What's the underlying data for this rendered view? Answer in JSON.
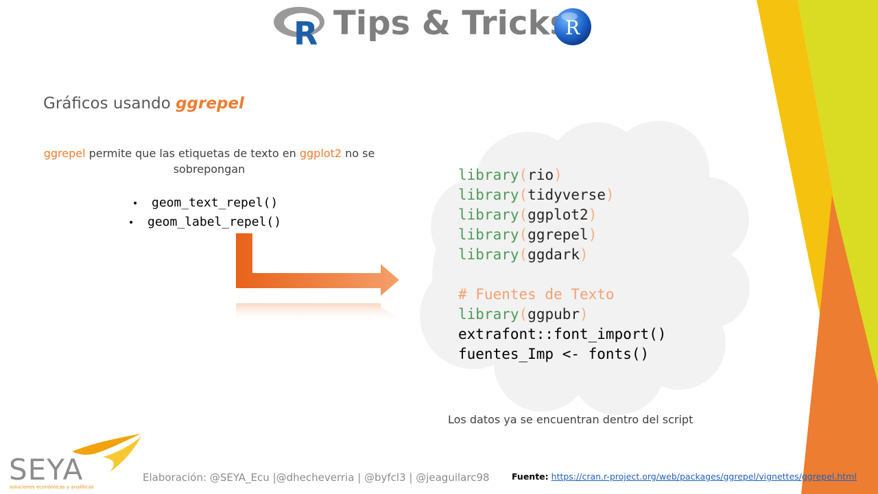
{
  "header": {
    "title": "Tips & Tricks",
    "left_logo_letter": "R",
    "right_logo_letter": "R",
    "left_logo_icon": "r-logo-icon",
    "right_logo_icon": "r-ball-icon"
  },
  "section": {
    "title_prefix": "Gráficos usando ",
    "title_package": "ggrepel"
  },
  "description": {
    "part1": "ggrepel",
    "part2": " permite que las etiquetas de texto en ",
    "part3": "ggplot2",
    "part4": " no se sobrepongan"
  },
  "bullets": [
    "geom_text_repel()",
    "geom_label_repel()"
  ],
  "bullet_symbol": "•",
  "code": [
    {
      "fn": "library",
      "open": "(",
      "arg": "rio",
      "close": ")"
    },
    {
      "fn": "library",
      "open": "(",
      "arg": "tidyverse",
      "close": ")"
    },
    {
      "fn": "library",
      "open": "(",
      "arg": "ggplot2",
      "close": ")"
    },
    {
      "fn": "library",
      "open": "(",
      "arg": "ggrepel",
      "close": ")"
    },
    {
      "fn": "library",
      "open": "(",
      "arg": "ggdark",
      "close": ")"
    },
    {
      "comment": "# Fuentes de Texto"
    },
    {
      "fn": "library",
      "open": "(",
      "arg": "ggpubr",
      "close": ")"
    },
    {
      "plain": "extrafont::font_import()"
    },
    {
      "plain": "fuentes_Imp <- fonts()"
    }
  ],
  "note": "Los datos ya se encuentran dentro del script",
  "footer": {
    "logo_text": "SEYA",
    "logo_tagline": "soluciones económicas y analíticas",
    "credits": "Elaboración: @SEYA_Ecu |@dhecheverria | @byfcl3 | @jeaguilarc98",
    "source_label": "Fuente:",
    "source_url": "https://cran.r-project.org/web/packages/ggrepel/vignettes/ggrepel.html"
  },
  "colors": {
    "accent_orange": "#ed7d31",
    "accent_yellow": "#f5c20f",
    "accent_lime": "#d9dc22",
    "code_green": "#4e9a58",
    "title_gray": "#7f7f7f"
  },
  "icons": [
    "r-logo-icon",
    "r-ball-icon",
    "arrow-icon",
    "cloud-shape",
    "seya-swoosh-icon"
  ]
}
